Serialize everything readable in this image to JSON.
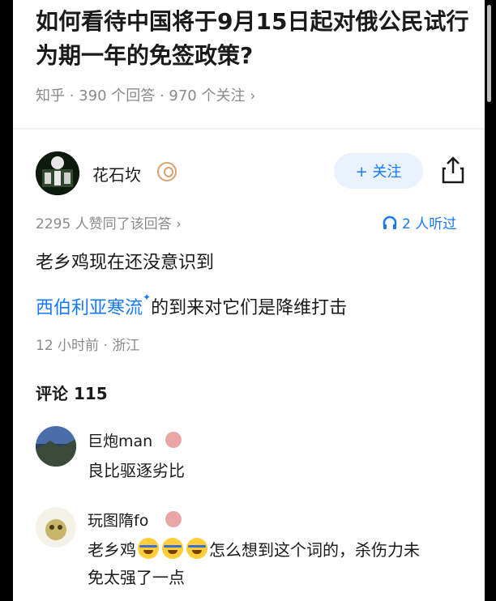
{
  "question": {
    "title": "如何看待中国将于9月15日起对俄公民试行为期一年的免签政策?",
    "meta": "知乎 · 390 个回答 · 970 个关注 ›"
  },
  "author": {
    "name": "花石坎",
    "follow_label": "+ 关注"
  },
  "stats": {
    "likes": "2295 人赞同了该回答 ›",
    "listeners": "2 人听过"
  },
  "answer": {
    "line1": "老乡鸡现在还没意识到",
    "keyword": "西伯利亚寒流",
    "line2_rest": "的到来对它们是降维打击",
    "time": "12 小时前 · 浙江"
  },
  "comments_header": "评论 115",
  "comments": [
    {
      "name": "巨炮man",
      "text": "良比驱逐劣比"
    },
    {
      "name": "玩图隋fo",
      "text_before": "老乡鸡",
      "text_after": "怎么想到这个词的，杀伤力未",
      "text_line2": "免太强了一点"
    }
  ],
  "colors": {
    "accent": "#1677ff",
    "text": "#1a1a1a",
    "meta": "#8a8a8a"
  },
  "icons": [
    "share-icon",
    "headphones-icon",
    "laughing-crying-emoji"
  ]
}
